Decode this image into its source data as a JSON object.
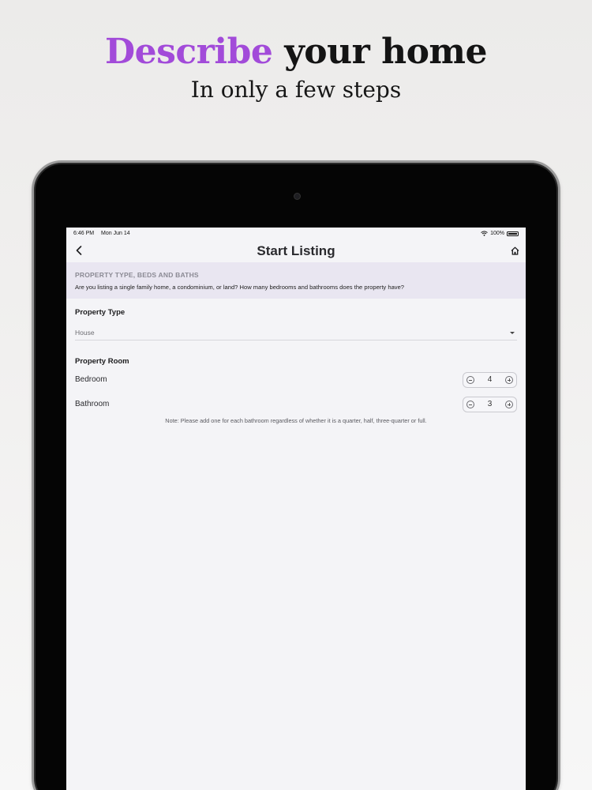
{
  "promo": {
    "headline_accent": "Describe",
    "headline_rest": " your home",
    "subline": "In only a few steps",
    "accent_color": "#a24bd9"
  },
  "status_bar": {
    "time": "6:46 PM",
    "date": "Mon Jun 14",
    "battery": "100%"
  },
  "nav": {
    "title": "Start Listing",
    "back_icon": "chevron-left-icon",
    "home_icon": "home-icon"
  },
  "banner": {
    "title": "PROPERTY TYPE, BEDS AND BATHS",
    "description": "Are you listing a single family home, a condominium, or land?  How many bedrooms and bathrooms does the property have?"
  },
  "property_type": {
    "label": "Property Type",
    "value": "House"
  },
  "property_room": {
    "label": "Property Room",
    "rooms": [
      {
        "name": "Bedroom",
        "value": "4"
      },
      {
        "name": "Bathroom",
        "value": "3"
      }
    ],
    "note": "Note: Please add one for each bathroom regardless of whether it is a quarter, half, three-quarter or full."
  }
}
